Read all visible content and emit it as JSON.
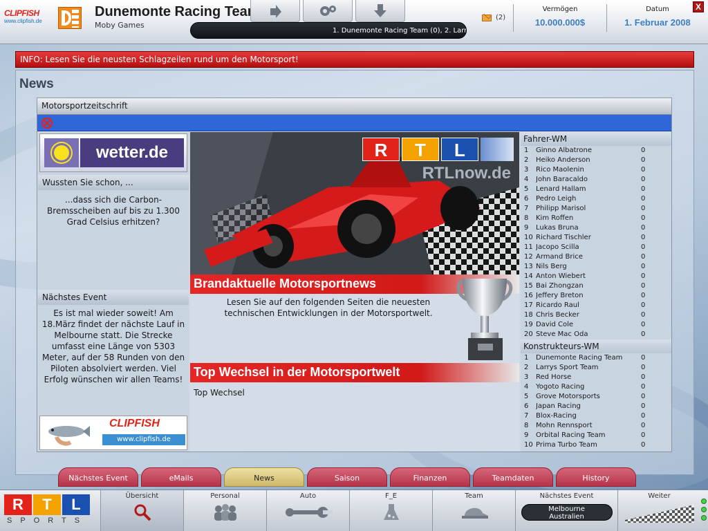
{
  "header": {
    "clipfish_logo": "CLIPFISH",
    "clipfish_url": "www.clipfish.de",
    "team_name": "Dunemonte Racing Team",
    "team_sub": "Moby Games",
    "ticker": "1. Dunemonte Racing Team (0),   2. Larr",
    "mail_count": "(2)",
    "money_label": "Vermögen",
    "money_value": "10.000.000$",
    "date_label": "Datum",
    "date_value": "1. Februar 2008",
    "close": "X"
  },
  "info": "INFO: Lesen Sie die neusten Schlagzeilen rund um den Motorsport!",
  "section_title": "News",
  "magazine": {
    "title": "Motorsportzeitschrift",
    "wetter_ad": "wetter.de",
    "did_you_know_title": "Wussten Sie schon, ...",
    "did_you_know_text": "...dass sich die Carbon-Bremsscheiben auf bis zu 1.300 Grad Celsius erhitzen?",
    "next_event_title": "Nächstes Event",
    "next_event_text": "Es ist mal wieder soweit! Am 18.März findet der nächste Lauf in Melbourne statt. Die Strecke umfasst eine Länge von 5303 Meter, auf der 58 Runden von den Piloten absolviert werden. Viel Erfolg wünschen wir allen Teams!",
    "clipfish_ad_name": "CLIPFISH",
    "clipfish_ad_url": "www.clipfish.de",
    "rtl_letters": [
      "R",
      "T",
      "L"
    ],
    "rtlnow": "RTLnow.de",
    "headline1": "Brandaktuelle Motorsportnews",
    "headline1_text": "Lesen Sie auf den folgenden Seiten die neuesten technischen Entwicklungen in der Motorsportwelt.",
    "headline2": "Top Wechsel in der Motorsportwelt",
    "headline2_text": "Top Wechsel"
  },
  "drivers_title": "Fahrer-WM",
  "drivers": [
    {
      "pos": "1",
      "name": "Ginno Albatrone",
      "pts": "0"
    },
    {
      "pos": "2",
      "name": "Heiko Anderson",
      "pts": "0"
    },
    {
      "pos": "3",
      "name": "Rico Maolenin",
      "pts": "0"
    },
    {
      "pos": "4",
      "name": "John Baracaldo",
      "pts": "0"
    },
    {
      "pos": "5",
      "name": "Lenard Hallam",
      "pts": "0"
    },
    {
      "pos": "6",
      "name": "Pedro Leigh",
      "pts": "0"
    },
    {
      "pos": "7",
      "name": "Philipp Marisol",
      "pts": "0"
    },
    {
      "pos": "8",
      "name": "Kim Roffen",
      "pts": "0"
    },
    {
      "pos": "9",
      "name": "Lukas Bruna",
      "pts": "0"
    },
    {
      "pos": "10",
      "name": "Richard Tischler",
      "pts": "0"
    },
    {
      "pos": "11",
      "name": "Jacopo Scilla",
      "pts": "0"
    },
    {
      "pos": "12",
      "name": "Armand Brice",
      "pts": "0"
    },
    {
      "pos": "13",
      "name": "Nils Berg",
      "pts": "0"
    },
    {
      "pos": "14",
      "name": "Anton Wiebert",
      "pts": "0"
    },
    {
      "pos": "15",
      "name": "Bai Zhongzan",
      "pts": "0"
    },
    {
      "pos": "16",
      "name": "Jeffery Breton",
      "pts": "0"
    },
    {
      "pos": "17",
      "name": "Ricardo Raul",
      "pts": "0"
    },
    {
      "pos": "18",
      "name": "Chris Becker",
      "pts": "0"
    },
    {
      "pos": "19",
      "name": "David Cole",
      "pts": "0"
    },
    {
      "pos": "20",
      "name": "Steve Mac Oda",
      "pts": "0"
    }
  ],
  "constructors_title": "Konstrukteurs-WM",
  "constructors": [
    {
      "pos": "1",
      "name": "Dunemonte Racing Team",
      "pts": "0"
    },
    {
      "pos": "2",
      "name": "Larrys Sport Team",
      "pts": "0"
    },
    {
      "pos": "3",
      "name": "Red Horse",
      "pts": "0"
    },
    {
      "pos": "4",
      "name": "Yogoto Racing",
      "pts": "0"
    },
    {
      "pos": "5",
      "name": "Grove Motorsports",
      "pts": "0"
    },
    {
      "pos": "6",
      "name": "Japan Racing",
      "pts": "0"
    },
    {
      "pos": "7",
      "name": "Blox-Racing",
      "pts": "0"
    },
    {
      "pos": "8",
      "name": "Mohn Rennsport",
      "pts": "0"
    },
    {
      "pos": "9",
      "name": "Orbital Racing Team",
      "pts": "0"
    },
    {
      "pos": "10",
      "name": "Prima Turbo Team",
      "pts": "0"
    }
  ],
  "tabs": [
    {
      "label": "Nächstes Event"
    },
    {
      "label": "eMails"
    },
    {
      "label": "News",
      "active": true
    },
    {
      "label": "Saison"
    },
    {
      "label": "Finanzen"
    },
    {
      "label": "Teamdaten"
    },
    {
      "label": "History"
    }
  ],
  "bottom_nav": {
    "logo_letters": [
      "R",
      "T",
      "L"
    ],
    "logo_sports": "SPORTS",
    "items": [
      {
        "label": "Übersicht",
        "icon": "magnifier-icon",
        "active": true
      },
      {
        "label": "Personal",
        "icon": "people-icon"
      },
      {
        "label": "Auto",
        "icon": "wrench-icon"
      },
      {
        "label": "F_E",
        "icon": "flask-icon"
      },
      {
        "label": "Team",
        "icon": "cap-icon"
      },
      {
        "label": "Nächstes Event",
        "icon": "event-pill",
        "pill_line1": "Melbourne",
        "pill_line2": "Australien"
      },
      {
        "label": "Weiter",
        "icon": "checkered-flag-icon"
      }
    ]
  },
  "colors": {
    "rtl_red": "#e2231a",
    "rtl_blue": "#1a50b0",
    "accent_blue": "#3d7fc4",
    "info_red": "#c81a1a"
  }
}
